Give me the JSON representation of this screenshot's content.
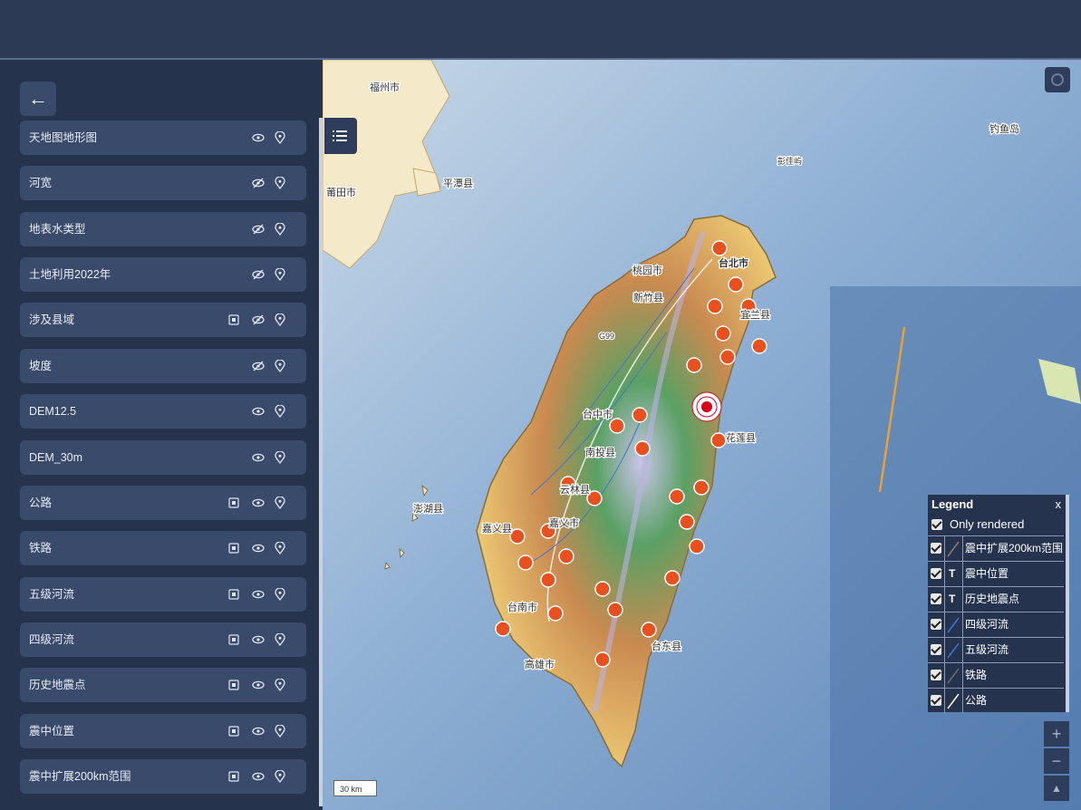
{
  "sidebar": {
    "layers": [
      {
        "name": "天地图地形图",
        "style_icon": false,
        "visible": true
      },
      {
        "name": "河宽",
        "style_icon": false,
        "visible": false
      },
      {
        "name": "地表水类型",
        "style_icon": false,
        "visible": false
      },
      {
        "name": "土地利用2022年",
        "style_icon": false,
        "visible": false
      },
      {
        "name": "涉及县域",
        "style_icon": true,
        "visible": false
      },
      {
        "name": "坡度",
        "style_icon": false,
        "visible": false
      },
      {
        "name": "DEM12.5",
        "style_icon": false,
        "visible": true
      },
      {
        "name": "DEM_30m",
        "style_icon": false,
        "visible": true
      },
      {
        "name": "公路",
        "style_icon": true,
        "visible": true
      },
      {
        "name": "铁路",
        "style_icon": true,
        "visible": true
      },
      {
        "name": "五级河流",
        "style_icon": true,
        "visible": true
      },
      {
        "name": "四级河流",
        "style_icon": true,
        "visible": true
      },
      {
        "name": "历史地震点",
        "style_icon": true,
        "visible": true
      },
      {
        "name": "震中位置",
        "style_icon": true,
        "visible": true
      },
      {
        "name": "震中扩展200km范围",
        "style_icon": true,
        "visible": true
      }
    ]
  },
  "map": {
    "labels": [
      {
        "text": "福州市"
      },
      {
        "text": "平潭县"
      },
      {
        "text": "钓鱼岛"
      },
      {
        "text": "彭佳屿"
      },
      {
        "text": "台北市"
      },
      {
        "text": "桃园市"
      },
      {
        "text": "新竹县"
      },
      {
        "text": "宜兰县"
      },
      {
        "text": "台中市"
      },
      {
        "text": "南投县"
      },
      {
        "text": "花莲县"
      },
      {
        "text": "云林县"
      },
      {
        "text": "澎湖县"
      },
      {
        "text": "嘉义县"
      },
      {
        "text": "嘉义市"
      },
      {
        "text": "台南市"
      },
      {
        "text": "高雄市"
      },
      {
        "text": "台东县"
      },
      {
        "text": "G99"
      },
      {
        "text": "莆田市"
      }
    ],
    "scale_label": "30 km",
    "zoom_in": "+",
    "zoom_out": "−",
    "north_arrow": "▲"
  },
  "legend": {
    "title": "Legend",
    "close": "x",
    "only_rendered_label": "Only rendered",
    "items": [
      {
        "label": "震中扩展200km范围",
        "symbol": "line-gray"
      },
      {
        "label": "震中位置",
        "symbol": "T"
      },
      {
        "label": "历史地震点",
        "symbol": "T"
      },
      {
        "label": "四级河流",
        "symbol": "line-blue"
      },
      {
        "label": "五级河流",
        "symbol": "line-blue"
      },
      {
        "label": "铁路",
        "symbol": "line-gray"
      },
      {
        "label": "公路",
        "symbol": "line-white"
      }
    ]
  },
  "colors": {
    "accent": "#3a4a6b",
    "epicenter": "#d8001a",
    "quake_marker": "#e8501f"
  }
}
